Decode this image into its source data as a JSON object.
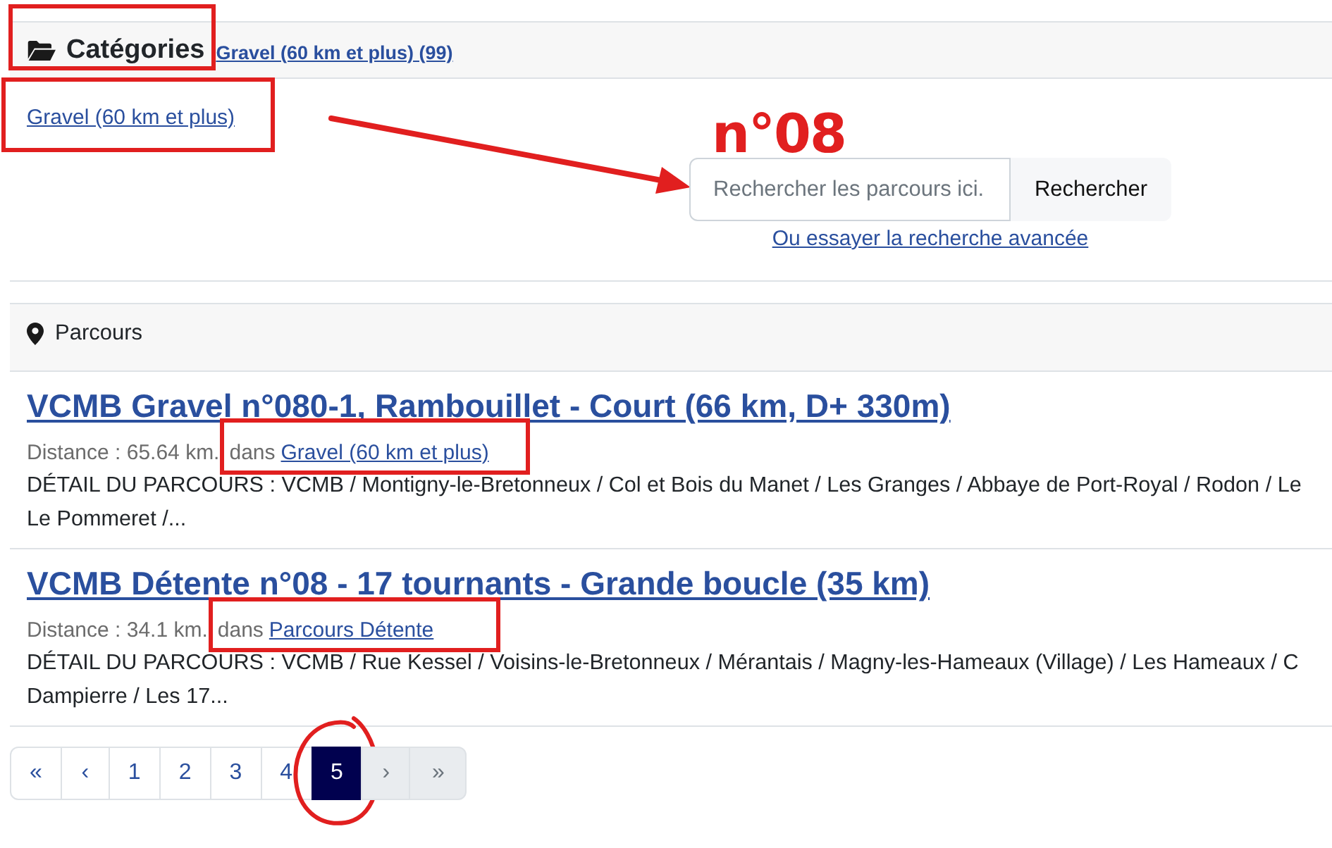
{
  "categories": {
    "title": "Catégories",
    "breadcrumb": "Gravel (60 km et plus) (99)",
    "boxed": true,
    "items": [
      {
        "label": "Gravel (60 km et plus)",
        "boxed": true
      }
    ]
  },
  "search": {
    "placeholder": "Rechercher les parcours ici.",
    "button": "Rechercher",
    "advanced_link": "Ou essayer la recherche avancée",
    "note": "n°08",
    "arrow": true
  },
  "routes": {
    "title": "Parcours",
    "items": [
      {
        "title": "VCMB Gravel n°080-1, Rambouillet - Court (66 km, D+ 330m)",
        "distance": "Distance : 65.64 km.",
        "in": "dans",
        "category": "Gravel (60 km et plus)",
        "category_boxed": true,
        "description": [
          "DÉTAIL DU PARCOURS : VCMB / Montigny-le-Bretonneux / Col et Bois du Manet / Les Granges / Abbaye de Port-Royal / Rodon / Le",
          "Le Pommeret /..."
        ]
      },
      {
        "title": "VCMB Détente n°08 - 17 tournants - Grande boucle (35 km)",
        "distance": "Distance : 34.1 km.",
        "in": "dans",
        "category": "Parcours Détente",
        "category_boxed": true,
        "description": [
          "DÉTAIL DU PARCOURS : VCMB / Rue Kessel / Voisins-le-Bretonneux / Mérantais / Magny-les-Hameaux (Village) / Les Hameaux / C",
          "Dampierre / Les 17..."
        ]
      }
    ]
  },
  "pagination": [
    {
      "label": "«",
      "selected": false,
      "disabled": false,
      "circled": false
    },
    {
      "label": "‹",
      "selected": false,
      "disabled": false,
      "circled": false
    },
    {
      "label": "1",
      "selected": false,
      "disabled": false,
      "circled": false
    },
    {
      "label": "2",
      "selected": false,
      "disabled": false,
      "circled": false
    },
    {
      "label": "3",
      "selected": false,
      "disabled": false,
      "circled": false
    },
    {
      "label": "4",
      "selected": false,
      "disabled": false,
      "circled": false
    },
    {
      "label": "5",
      "selected": true,
      "disabled": false,
      "circled": true
    },
    {
      "label": "›",
      "selected": false,
      "disabled": true,
      "circled": false
    },
    {
      "label": "»",
      "selected": false,
      "disabled": true,
      "circled": false
    }
  ]
}
